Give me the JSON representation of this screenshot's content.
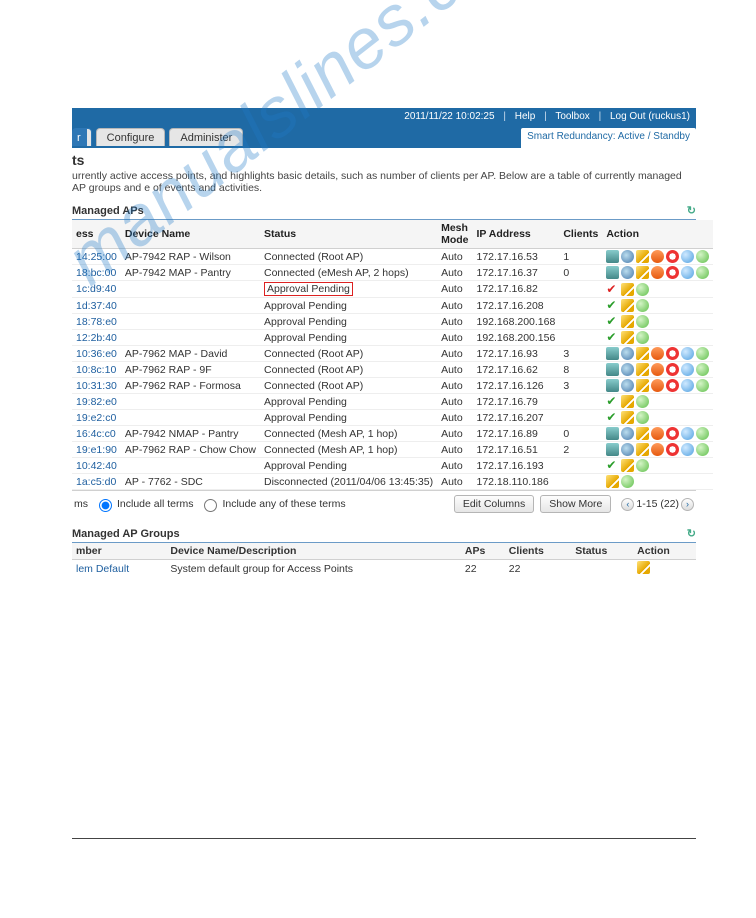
{
  "topbar": {
    "datetime": "2011/11/22 10:02:25",
    "help": "Help",
    "toolbox": "Toolbox",
    "logout": "Log Out (ruckus1)"
  },
  "nav": {
    "tab_frag": "r",
    "tab_configure": "Configure",
    "tab_administer": "Administer"
  },
  "redundancy": "Smart Redundancy: Active / Standby",
  "title_fragment": "ts",
  "description_frag": "urrently active access points, and highlights basic details, such as number of clients per AP. Below are a table of currently managed AP groups and e of events and activities.",
  "panels": {
    "managed_aps": "Managed APs",
    "managed_groups": "Managed AP Groups"
  },
  "columns": {
    "ess": "ess",
    "device": "Device Name",
    "status": "Status",
    "mesh": "Mesh Mode",
    "ip": "IP Address",
    "clients": "Clients",
    "action": "Action"
  },
  "rows": [
    {
      "mac": "14:25:00",
      "name": "AP-7942 RAP - Wilson",
      "status": "Connected (Root AP)",
      "mesh": "Auto",
      "ip": "172.17.16.53",
      "clients": "1",
      "actions": "full"
    },
    {
      "mac": "18:bc:00",
      "name": "AP-7942 MAP - Pantry",
      "status": "Connected (eMesh AP, 2 hops)",
      "mesh": "Auto",
      "ip": "172.17.16.37",
      "clients": "0",
      "actions": "full"
    },
    {
      "mac": "1c:d9:40",
      "name": "",
      "status": "Approval Pending",
      "mesh": "Auto",
      "ip": "172.17.16.82",
      "clients": "",
      "actions": "pending",
      "boxed": true,
      "red": true
    },
    {
      "mac": "1d:37:40",
      "name": "",
      "status": "Approval Pending",
      "mesh": "Auto",
      "ip": "172.17.16.208",
      "clients": "",
      "actions": "pending"
    },
    {
      "mac": "18:78:e0",
      "name": "",
      "status": "Approval Pending",
      "mesh": "Auto",
      "ip": "192.168.200.168",
      "clients": "",
      "actions": "pending"
    },
    {
      "mac": "12:2b:40",
      "name": "",
      "status": "Approval Pending",
      "mesh": "Auto",
      "ip": "192.168.200.156",
      "clients": "",
      "actions": "pending"
    },
    {
      "mac": "10:36:e0",
      "name": "AP-7962 MAP - David",
      "status": "Connected (Root AP)",
      "mesh": "Auto",
      "ip": "172.17.16.93",
      "clients": "3",
      "actions": "full"
    },
    {
      "mac": "10:8c:10",
      "name": "AP-7962 RAP - 9F",
      "status": "Connected (Root AP)",
      "mesh": "Auto",
      "ip": "172.17.16.62",
      "clients": "8",
      "actions": "full"
    },
    {
      "mac": "10:31:30",
      "name": "AP-7962 RAP - Formosa",
      "status": "Connected (Root AP)",
      "mesh": "Auto",
      "ip": "172.17.16.126",
      "clients": "3",
      "actions": "full"
    },
    {
      "mac": "19:82:e0",
      "name": "",
      "status": "Approval Pending",
      "mesh": "Auto",
      "ip": "172.17.16.79",
      "clients": "",
      "actions": "pending"
    },
    {
      "mac": "19:e2:c0",
      "name": "",
      "status": "Approval Pending",
      "mesh": "Auto",
      "ip": "172.17.16.207",
      "clients": "",
      "actions": "pending"
    },
    {
      "mac": "16:4c:c0",
      "name": "AP-7942 NMAP - Pantry",
      "status": "Connected (Mesh AP, 1 hop)",
      "mesh": "Auto",
      "ip": "172.17.16.89",
      "clients": "0",
      "actions": "full"
    },
    {
      "mac": "19:e1:90",
      "name": "AP-7962 RAP - Chow Chow",
      "status": "Connected (Mesh AP, 1 hop)",
      "mesh": "Auto",
      "ip": "172.17.16.51",
      "clients": "2",
      "actions": "full"
    },
    {
      "mac": "10:42:40",
      "name": "",
      "status": "Approval Pending",
      "mesh": "Auto",
      "ip": "172.17.16.193",
      "clients": "",
      "actions": "pending"
    },
    {
      "mac": "1a:c5:d0",
      "name": "AP - 7762 - SDC",
      "status": "Disconnected (2011/04/06 13:45:35)",
      "mesh": "Auto",
      "ip": "172.18.110.186",
      "clients": "",
      "actions": "disc"
    }
  ],
  "footer": {
    "terms_label": "ms",
    "include_all": "Include all terms",
    "include_any": "Include any of these terms",
    "edit_columns": "Edit Columns",
    "show_more": "Show More",
    "page_range": "1-15 (22)"
  },
  "groups_cols": {
    "number": "mber",
    "name": "Device Name/Description",
    "aps": "APs",
    "clients": "Clients",
    "status": "Status",
    "action": "Action"
  },
  "groups_rows": [
    {
      "id": "lem Default",
      "desc": "System default group for Access Points",
      "aps": "22",
      "clients": "22",
      "status": "",
      "action": "edit"
    }
  ],
  "watermark": "manualslines.com"
}
